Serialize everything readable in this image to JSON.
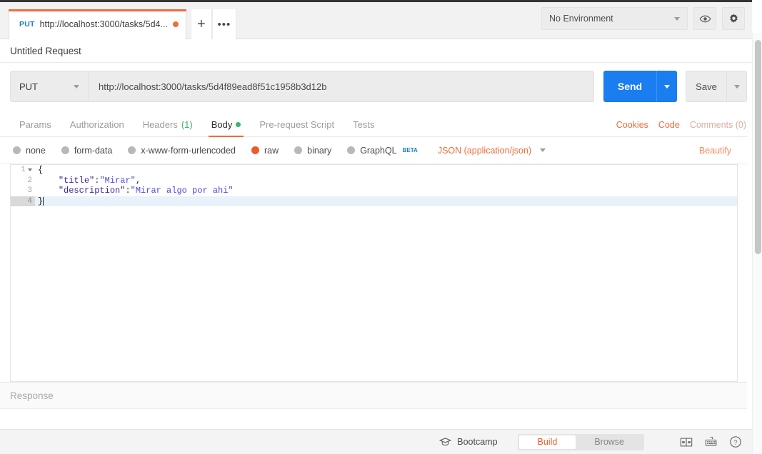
{
  "window": {
    "tab": {
      "method": "PUT",
      "url_short": "http://localhost:3000/tasks/5d4...",
      "unsaved_dot": "●"
    },
    "new_tab_label": "+",
    "tab_menu_label": "•••"
  },
  "environment": {
    "selected": "No Environment",
    "eye_icon": "eye-icon",
    "settings_icon": "gear-icon"
  },
  "request": {
    "name": "Untitled Request",
    "method": "PUT",
    "url": "http://localhost:3000/tasks/5d4f89ead8f51c1958b3d12b",
    "send_label": "Send",
    "save_label": "Save"
  },
  "tabs": [
    {
      "label": "Params",
      "active": false
    },
    {
      "label": "Authorization",
      "active": false
    },
    {
      "label": "Headers",
      "count": "(1)",
      "active": false
    },
    {
      "label": "Body",
      "active": true,
      "dot": true
    },
    {
      "label": "Pre-request Script",
      "active": false
    },
    {
      "label": "Tests",
      "active": false
    }
  ],
  "tab_right_links": {
    "cookies": "Cookies",
    "code": "Code",
    "comments": "Comments (0)"
  },
  "body_types": [
    {
      "label": "none",
      "selected": false
    },
    {
      "label": "form-data",
      "selected": false
    },
    {
      "label": "x-www-form-urlencoded",
      "selected": false
    },
    {
      "label": "raw",
      "selected": true
    },
    {
      "label": "binary",
      "selected": false
    },
    {
      "label": "GraphQL",
      "selected": false,
      "badge": "BETA"
    }
  ],
  "content_type": {
    "selected": "JSON (application/json)"
  },
  "beautify_label": "Beautify",
  "editor": {
    "lines": [
      {
        "num": "1",
        "foldable": true,
        "active": false,
        "tokens": [
          {
            "t": "{",
            "c": "tk-brace"
          }
        ]
      },
      {
        "num": "2",
        "foldable": false,
        "active": false,
        "tokens": [
          {
            "t": "    ",
            "c": "tk-punct"
          },
          {
            "t": "\"title\"",
            "c": "tk-key"
          },
          {
            "t": ":",
            "c": "tk-punct"
          },
          {
            "t": "\"Mirar\"",
            "c": "tk-str"
          },
          {
            "t": ",",
            "c": "tk-punct"
          }
        ]
      },
      {
        "num": "3",
        "foldable": false,
        "active": false,
        "tokens": [
          {
            "t": "    ",
            "c": "tk-punct"
          },
          {
            "t": "\"description\"",
            "c": "tk-key"
          },
          {
            "t": ":",
            "c": "tk-punct"
          },
          {
            "t": "\"Mirar algo por ahi\"",
            "c": "tk-str"
          }
        ]
      },
      {
        "num": "4",
        "foldable": false,
        "active": true,
        "tokens": [
          {
            "t": "}",
            "c": "tk-brace"
          }
        ]
      }
    ],
    "raw_body": "{\n    \"title\":\"Mirar\",\n    \"description\":\"Mirar algo por ahi\"\n}"
  },
  "response": {
    "placeholder": "Response"
  },
  "statusbar": {
    "bootcamp_label": "Bootcamp",
    "bootcamp_icon": "graduation-cap-icon",
    "build_label": "Build",
    "browse_label": "Browse",
    "active_mode": "Build",
    "layout_icon": "two-pane-layout-icon",
    "keyboard_icon": "keyboard-icon",
    "help_icon": "help-circle-icon"
  },
  "colors": {
    "accent_orange": "#f26b3a",
    "send_blue": "#1a7ef0",
    "method_blue": "#1a7ec9",
    "green": "#3cb371",
    "radio_on": "#f05a28"
  }
}
